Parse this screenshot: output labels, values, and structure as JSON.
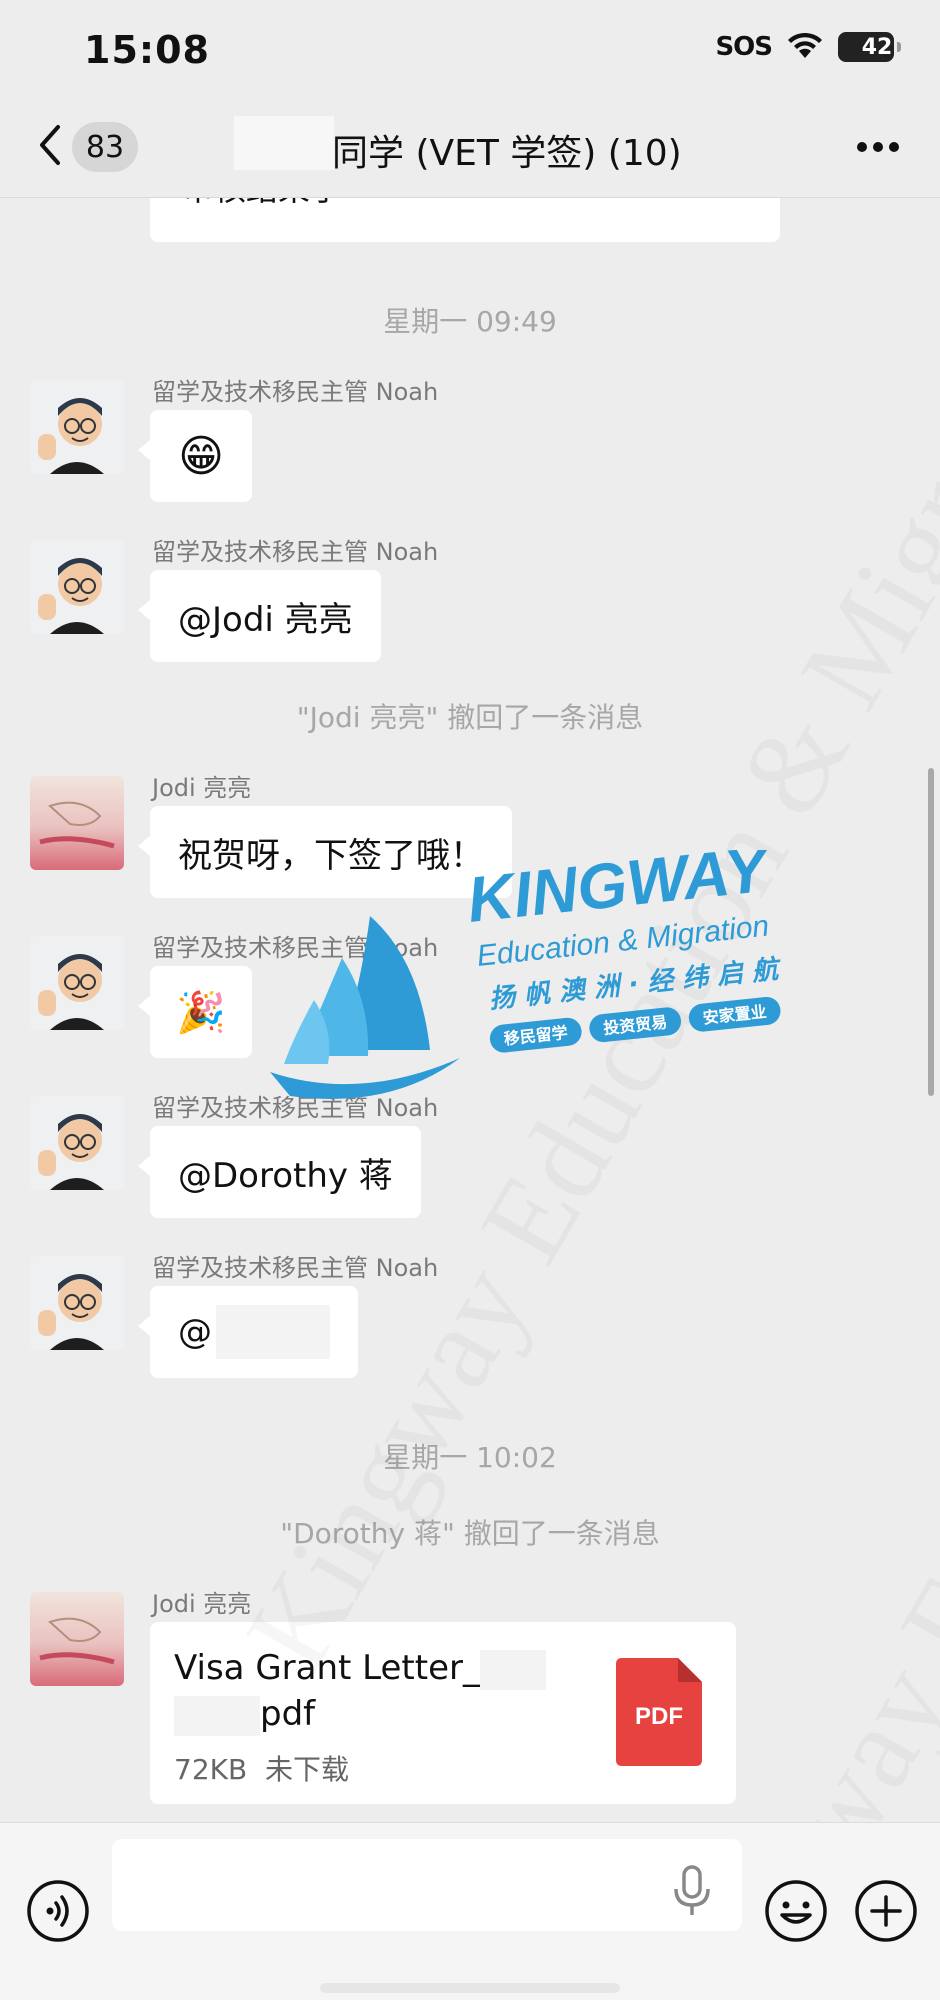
{
  "status_bar": {
    "time": "15:08",
    "sos": "SOS",
    "battery": "42"
  },
  "nav": {
    "back_count": "83",
    "title": "同学 (VET 学签) (10)"
  },
  "messages": {
    "partial_text": "审核结果了",
    "time_1": "星期一 09:49",
    "m1": {
      "sender": "留学及技术移民主管 Noah",
      "emoji": "😁"
    },
    "m2": {
      "sender": "留学及技术移民主管 Noah",
      "text": "@Jodi 亮亮"
    },
    "recall_1": "\"Jodi 亮亮\" 撤回了一条消息",
    "m3": {
      "sender": "Jodi 亮亮",
      "text": "祝贺呀，下签了哦！"
    },
    "m4": {
      "sender": "留学及技术移民主管 Noah",
      "emoji": "🎉"
    },
    "m5": {
      "sender": "留学及技术移民主管 Noah",
      "text": "@Dorothy 蒋"
    },
    "m6": {
      "sender": "留学及技术移民主管 Noah",
      "text": "@"
    },
    "time_2": "星期一 10:02",
    "recall_2": "\"Dorothy 蒋\" 撤回了一条消息",
    "m7": {
      "sender": "Jodi 亮亮",
      "file_name_1": "Visa Grant Letter_",
      "file_name_2": "pdf",
      "file_size": "72KB",
      "file_status": "未下载",
      "file_type": "PDF"
    }
  },
  "watermark": {
    "brand": "KINGWAY",
    "tagline": "Education & Migration",
    "slogan": "扬 帆 澳 洲 · 经 纬 启 航",
    "tag_1": "移民留学",
    "tag_2": "投资贸易",
    "tag_3": "安家置业",
    "background_text": "Kingway Education & Migration"
  },
  "input": {
    "placeholder": ""
  },
  "colors": {
    "background": "#ededed",
    "bubble": "#ffffff",
    "pdf": "#e64340",
    "brand_blue": "#2e9bd6"
  }
}
